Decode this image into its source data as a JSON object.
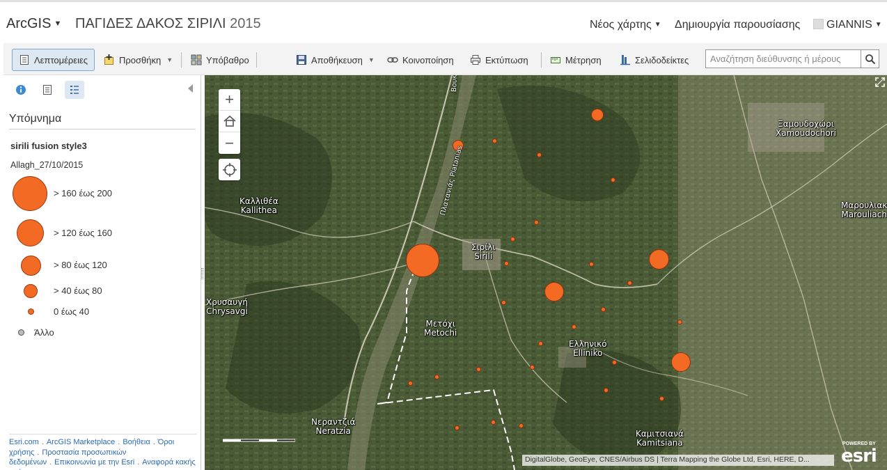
{
  "header": {
    "brand": "ArcGIS",
    "title": "ΠΑΓΙΔΕΣ ΔΑΚΟΣ ΣΙΡΙΛΙ",
    "year": "2015",
    "new_map": "Νέος χάρτης",
    "create_presentation": "Δημιουργία παρουσίασης",
    "user": "GIANNIS"
  },
  "toolbar": {
    "details": "Λεπτομέρειες",
    "add": "Προσθήκη",
    "basemap": "Υπόβαθρο",
    "save": "Αποθήκευση",
    "share": "Κοινοποίηση",
    "print": "Εκτύπωση",
    "measure": "Μέτρηση",
    "bookmarks": "Σελιδοδείκτες",
    "search_placeholder": "Αναζήτηση διεύθυνσης ή μέρους"
  },
  "panel": {
    "legend_title": "Υπόμνημα",
    "layer_name": "sirili fusion style3",
    "field_name": "Allagh_27/10/2015",
    "classes": [
      {
        "label": "> 160 έως 200"
      },
      {
        "label": "> 120 έως 160"
      },
      {
        "label": "> 80 έως 120"
      },
      {
        "label": "> 40 έως 80"
      },
      {
        "label": "0 έως 40"
      }
    ],
    "other_label": "Άλλο",
    "footer": {
      "esri": "Esri.com",
      "marketplace": "ArcGIS Marketplace",
      "help": "Βοήθεια",
      "terms": "Όροι χρήσης",
      "privacy": "Προστασία προσωπικών δεδομένων",
      "contact": "Επικοινωνία με την Esri",
      "report_abuse": "Αναφορά κακής χρήσης"
    }
  },
  "map": {
    "places": [
      {
        "name": "Καλλιθέα",
        "latin": "Kallithea"
      },
      {
        "name": "Σιρίλι",
        "latin": "Sirili"
      },
      {
        "name": "Χρυσαυγή",
        "latin": "Chrysavgi"
      },
      {
        "name": "Μετόχι",
        "latin": "Metochi"
      },
      {
        "name": "Ελληνικό",
        "latin": "Elliniko"
      },
      {
        "name": "Νεραντζιά",
        "latin": "Neratzia"
      },
      {
        "name": "Καμιτσιανά",
        "latin": "Kamitsiana"
      },
      {
        "name": "Ξαμουδοχώρι",
        "latin": "Xamoudochori"
      },
      {
        "name": "Μαρουλιακ",
        "latin": "Marouliach"
      }
    ],
    "roads": {
      "boukolies": "Βουκολιές",
      "plataniás": "Πλατανιάς Platanias"
    },
    "attribution": "DigitalGlobe, GeoEye, CNES/Airbus DS | Terra Mapping the Globe Ltd, Esri, HERE, D...",
    "esri_powered": "POWERED BY",
    "esri_name": "esri"
  },
  "colors": {
    "accent": "#f26a23",
    "link": "#2a6bb5"
  }
}
